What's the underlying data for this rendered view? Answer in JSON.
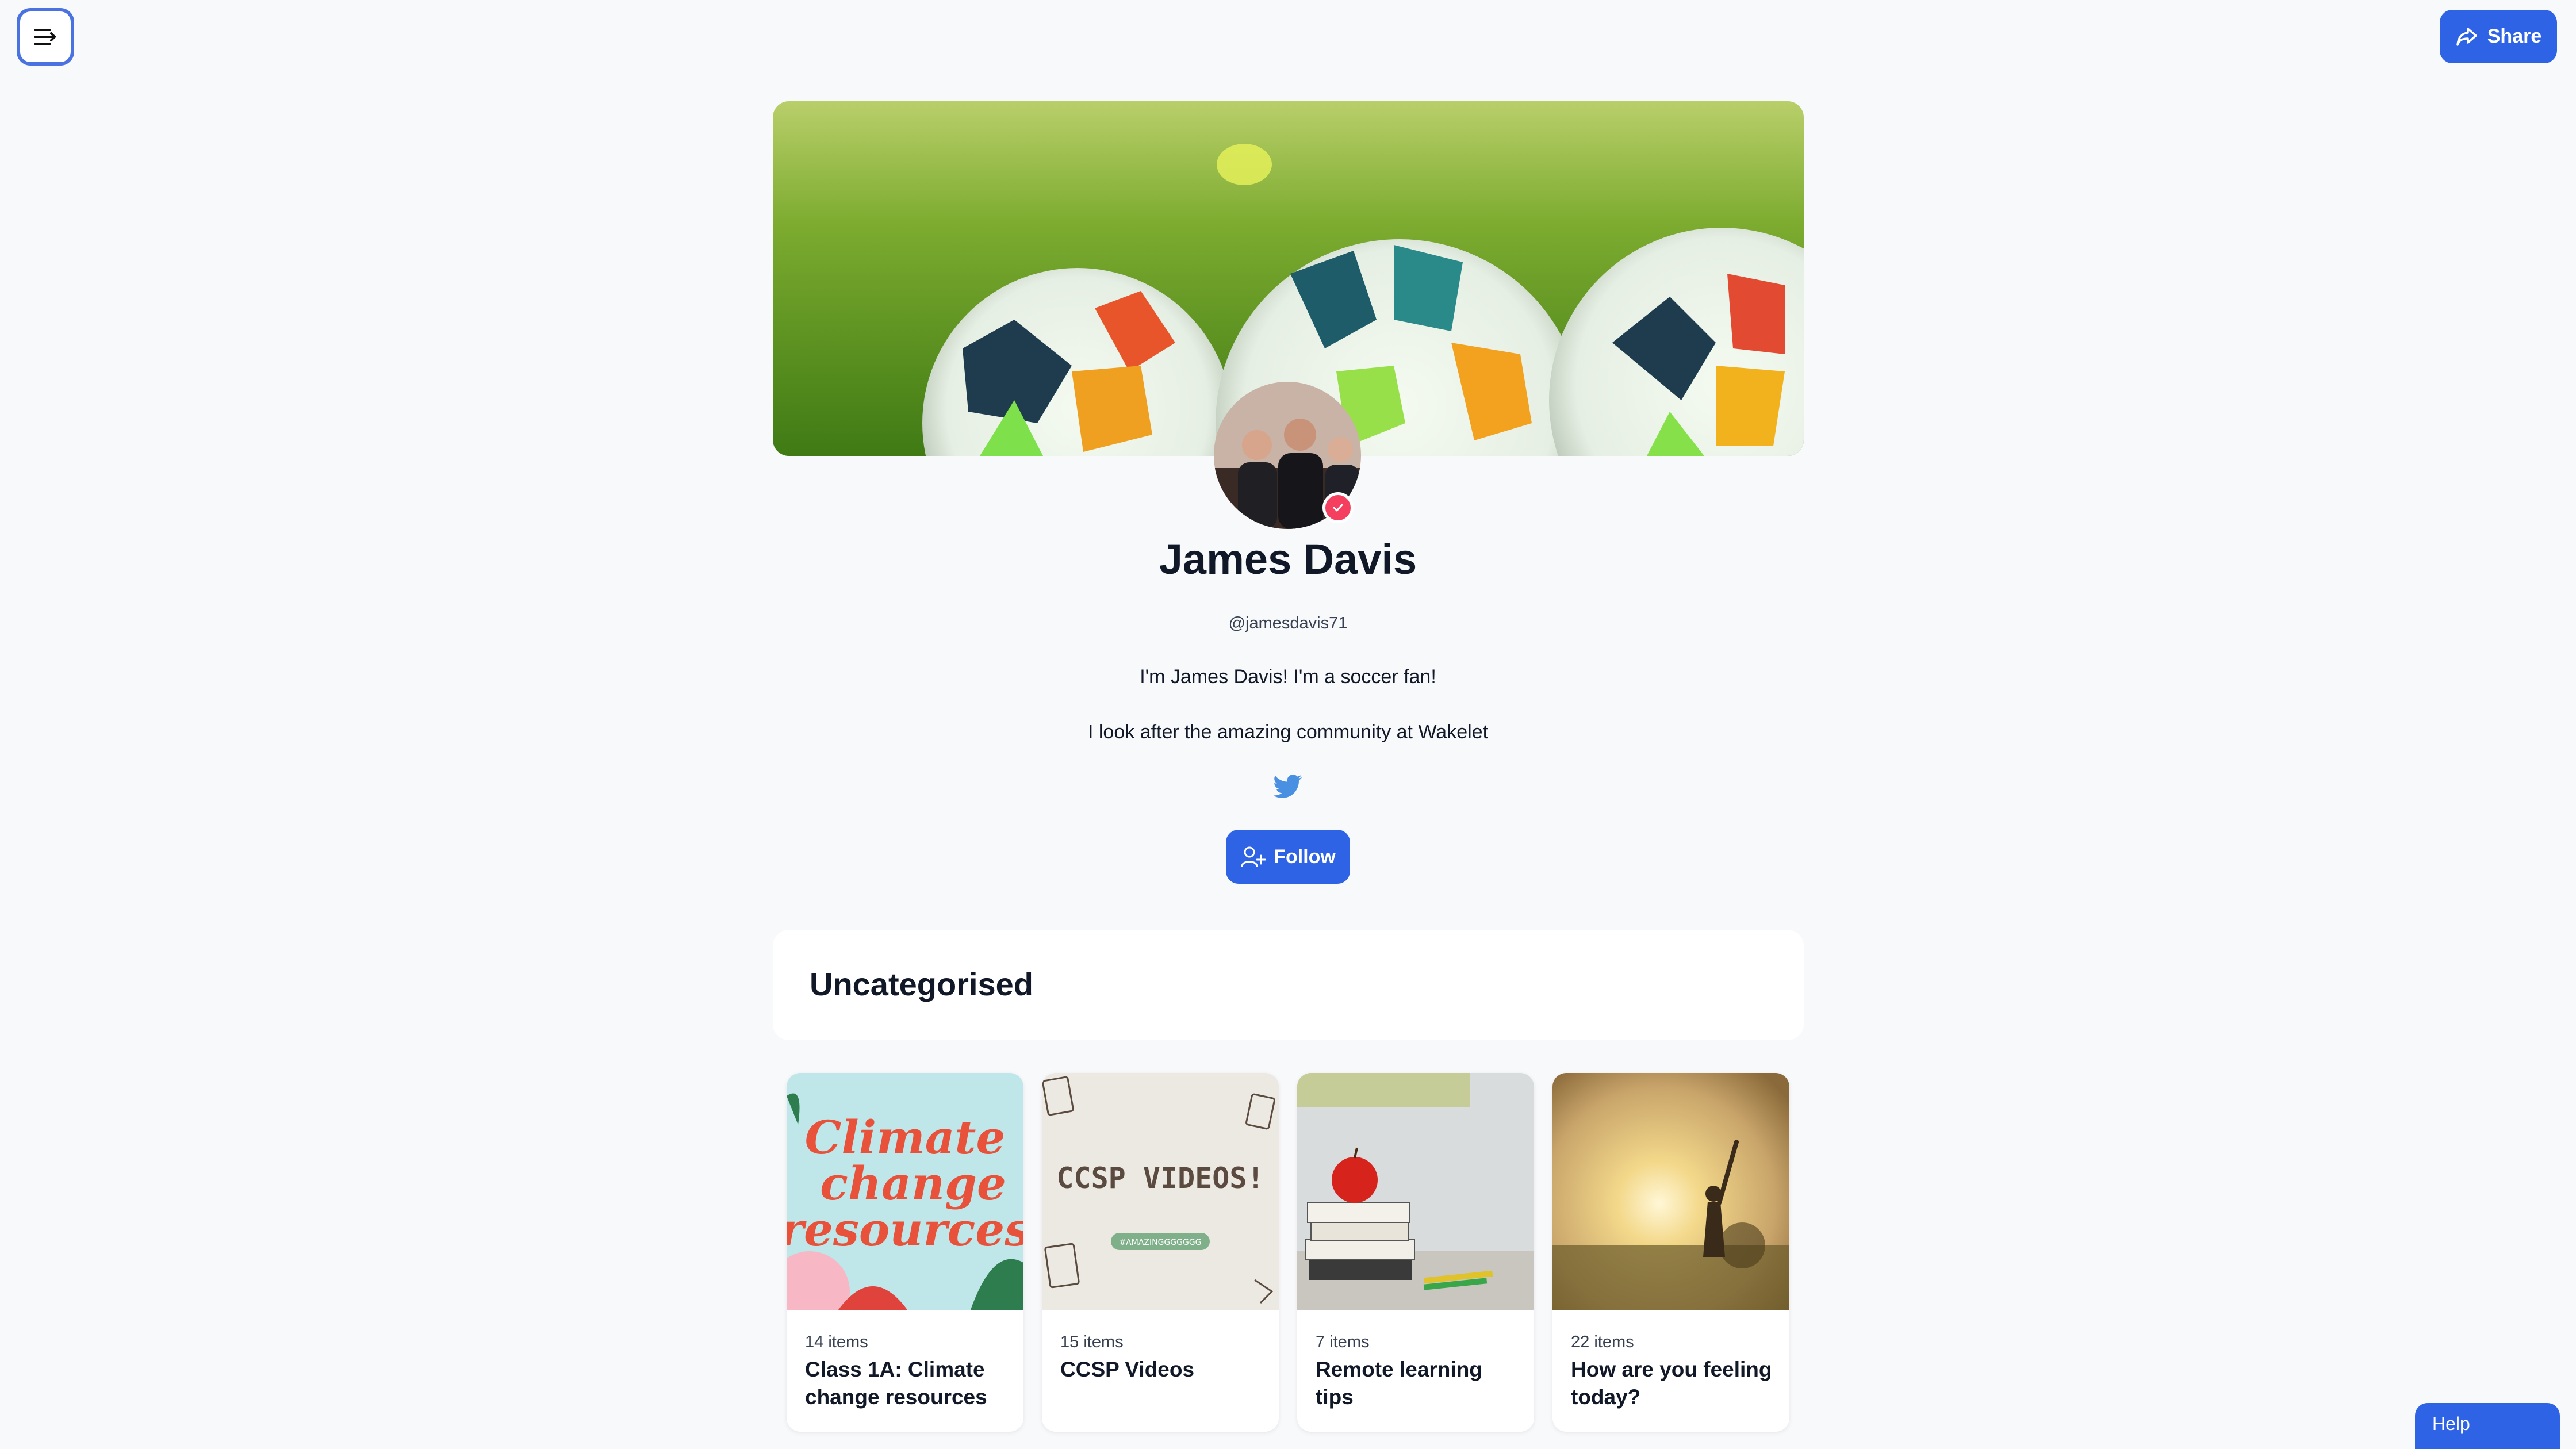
{
  "header": {
    "menu_icon": "menu-icon",
    "share_label": "Share",
    "share_icon": "share-arrow-icon"
  },
  "profile": {
    "name": "James Davis",
    "handle": "@jamesdavis71",
    "bio_line1": "I'm James Davis! I'm a soccer fan!",
    "bio_line2": "I look after the amazing community at Wakelet",
    "social_icon": "twitter-icon",
    "follow_label": "Follow",
    "verified_badge_icon": "check-icon"
  },
  "section": {
    "title": "Uncategorised"
  },
  "collections": [
    {
      "count": "14 items",
      "title": "Class 1A: Climate change resources",
      "thumb_text": [
        "Climate",
        "change",
        "resources"
      ]
    },
    {
      "count": "15 items",
      "title": "CCSP Videos",
      "thumb_text": [
        "CCSP VIDEOS!",
        "#AMAZINGGGGGGG"
      ]
    },
    {
      "count": "7 items",
      "title": "Remote learning tips"
    },
    {
      "count": "22 items",
      "title": "How are you feeling today?"
    }
  ],
  "help_label": "Help",
  "colors": {
    "accent": "#2f63e6",
    "background": "#f8f9fb",
    "verified": "#f43f5e",
    "twitter": "#4a90e2"
  }
}
